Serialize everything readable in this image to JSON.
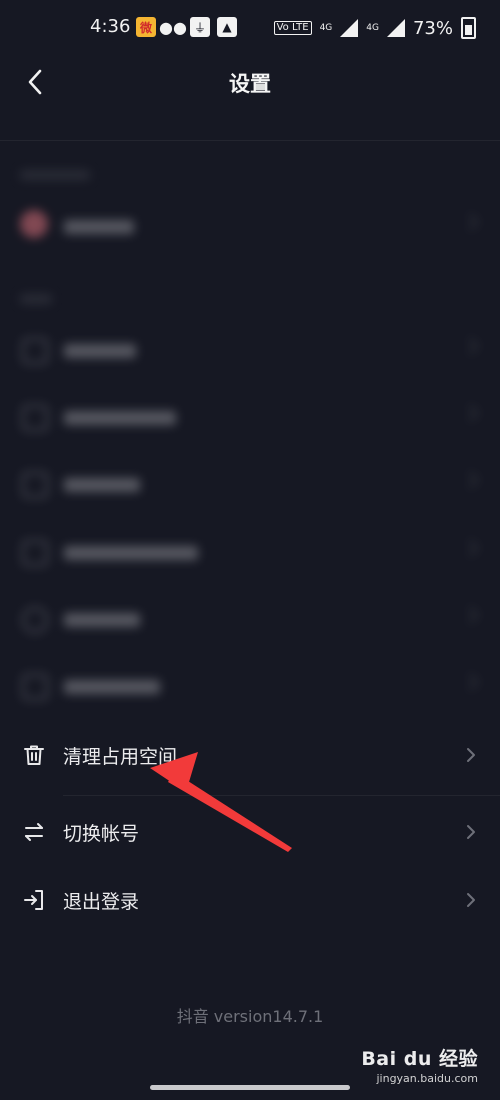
{
  "status_bar": {
    "time": "4:36",
    "volte_label": "Vo LTE",
    "net1": "4G",
    "net2": "4G",
    "battery": "73%"
  },
  "header": {
    "title": "设置"
  },
  "rows": [
    {
      "label": "清理占用空间",
      "icon": "trash-icon"
    },
    {
      "label": "切换帐号",
      "icon": "swap-icon"
    },
    {
      "label": "退出登录",
      "icon": "logout-icon"
    }
  ],
  "footer": {
    "version": "抖音 version14.7.1"
  },
  "watermark": {
    "brand": "Bai du 经验",
    "url": "jingyan.baidu.com"
  },
  "colors": {
    "background": "#161823",
    "annotation_arrow": "#f23a3a"
  }
}
